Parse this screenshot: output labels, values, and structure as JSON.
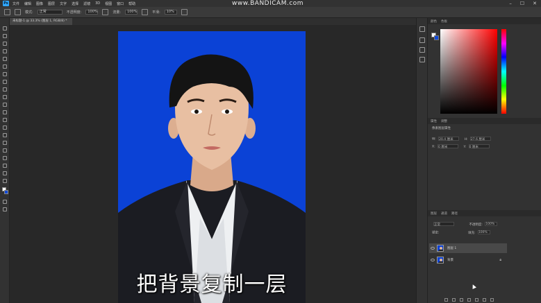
{
  "app": {
    "logo": "Ps"
  },
  "watermark": "www.BANDICAM.com",
  "menu": [
    {
      "label": "文件"
    },
    {
      "label": "编辑"
    },
    {
      "label": "图像"
    },
    {
      "label": "图层"
    },
    {
      "label": "文字"
    },
    {
      "label": "选择"
    },
    {
      "label": "滤镜"
    },
    {
      "label": "3D"
    },
    {
      "label": "视图"
    },
    {
      "label": "窗口"
    },
    {
      "label": "帮助"
    }
  ],
  "window_buttons": {
    "minimize": "–",
    "maximize": "☐",
    "close": "✕"
  },
  "options_bar": {
    "mode_label": "模式:",
    "mode_value": "正常",
    "opacity_label": "不透明度:",
    "opacity_value": "100%",
    "flow_label": "流量:",
    "flow_value": "100%",
    "smooth_label": "平滑:",
    "smooth_value": "10%"
  },
  "document_tab": {
    "title": "未标题-1 @ 33.3% (图层 1, RGB/8) *"
  },
  "subtitle": "把背景复制一层",
  "colors": {
    "canvas_bg": "#0b42d6",
    "foreground": "#ffffff",
    "background": "#1149d8",
    "ui_dark": "#282828",
    "panel": "#323232"
  },
  "panels": {
    "color_tabs": [
      "颜色",
      "色板"
    ],
    "properties_tabs": [
      "属性",
      "调整"
    ],
    "properties_title": "像素图层属性",
    "properties_fields": [
      {
        "label": "W:",
        "value": "20.4 厘米"
      },
      {
        "label": "H:",
        "value": "27.6 厘米"
      },
      {
        "label": "X:",
        "value": "0 厘米"
      },
      {
        "label": "Y:",
        "value": "0 厘米"
      }
    ],
    "layers_tabs": [
      "图层",
      "通道",
      "路径"
    ],
    "blend_mode": "正常",
    "layer_opacity_label": "不透明度:",
    "layer_opacity_value": "100%",
    "lock_label": "锁定:",
    "fill_label": "填充:",
    "fill_value": "100%",
    "layers": [
      {
        "name": "图层 1",
        "active": true,
        "locked": false
      },
      {
        "name": "背景",
        "active": false,
        "locked": true
      }
    ]
  },
  "icons": [
    "ps-logo",
    "brush-tool-icon",
    "move-tool-icon",
    "marquee-tool-icon",
    "lasso-tool-icon",
    "crop-tool-icon",
    "eyedropper-icon",
    "healing-brush-icon",
    "eraser-icon",
    "gradient-icon",
    "text-tool-icon",
    "pen-tool-icon",
    "hand-tool-icon",
    "zoom-tool-icon",
    "eye-icon",
    "lock-icon",
    "cursor-icon"
  ]
}
